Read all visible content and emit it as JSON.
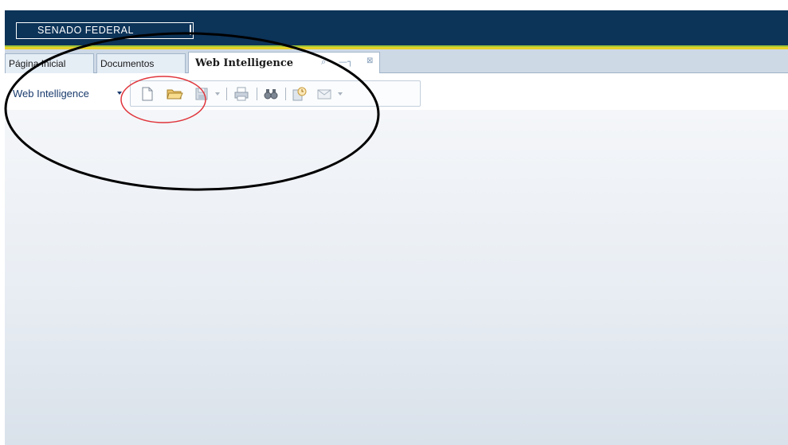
{
  "header": {
    "logo_text": "SENADO FEDERAL"
  },
  "tabs": [
    {
      "label": "Página Inicial"
    },
    {
      "label": "Documentos"
    },
    {
      "label": "Web Intelligence"
    }
  ],
  "tab_icons": {
    "pin": "pin-icon",
    "dock": "dock-icon",
    "close": "close-icon"
  },
  "toolbar": {
    "menu_label": "Web Intelligence",
    "buttons": [
      "new-document-icon",
      "open-folder-icon",
      "save-icon",
      "print-icon",
      "find-icon",
      "schedule-icon",
      "send-mail-icon"
    ]
  },
  "colors": {
    "header_bg": "#0c3358",
    "stripe_green": "#9ec33a",
    "stripe_yellow": "#e7d02a",
    "tabbar_bg": "#ced9e6",
    "annotation_black": "#000000",
    "annotation_red": "#e0353b"
  }
}
